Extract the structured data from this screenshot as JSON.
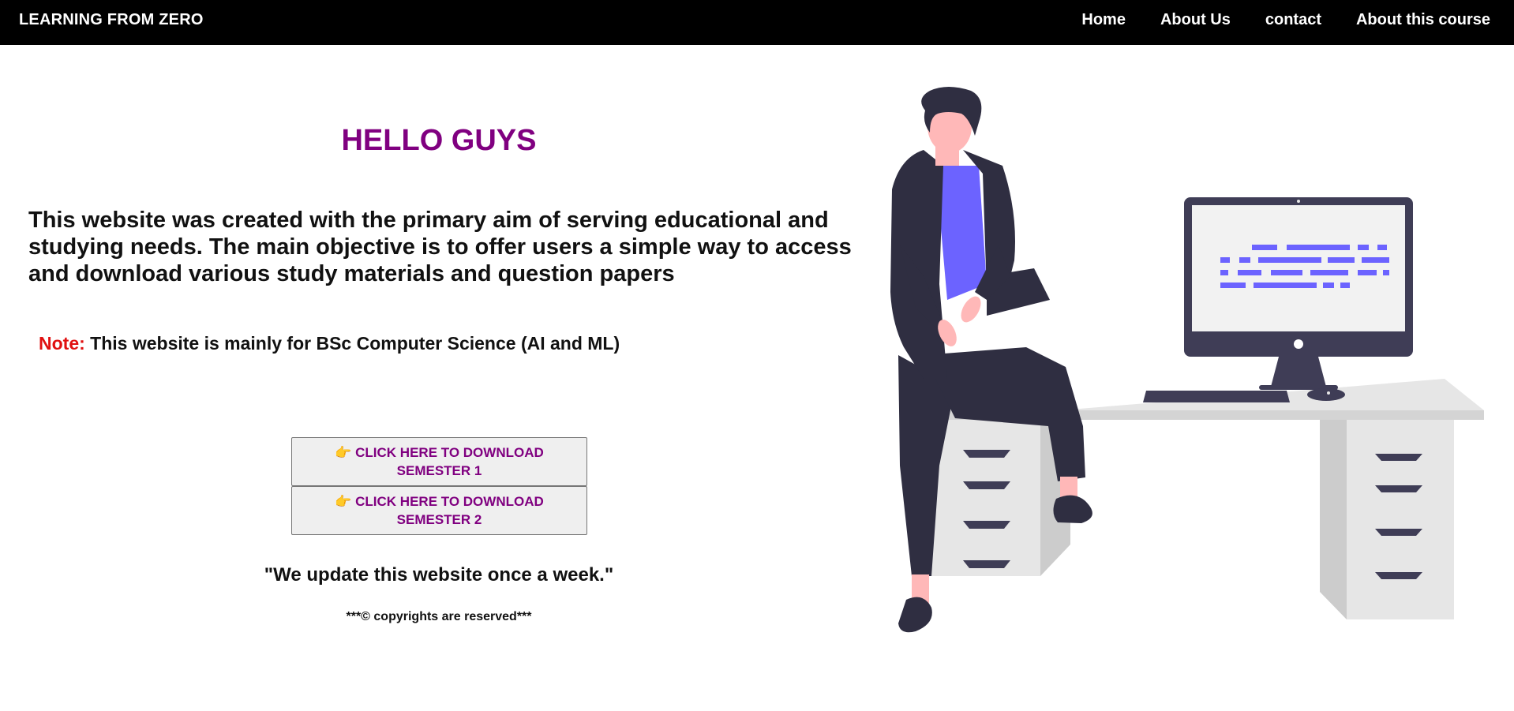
{
  "nav": {
    "brand": "LEARNING FROM ZERO",
    "links": [
      "Home",
      "About Us",
      "contact",
      "About this course"
    ]
  },
  "main": {
    "heading": "HELLO GUYS",
    "intro": "This website was created with the primary aim of serving educational and studying needs. The main objective is to offer users a simple way to access and download various study materials and question papers",
    "note_label": "Note:",
    "note_text": "This website is mainly for BSc Computer Science (AI and ML)",
    "buttons": [
      {
        "icon": "👉",
        "label": "CLICK HERE TO DOWNLOAD SEMESTER 1"
      },
      {
        "icon": "👉",
        "label": "CLICK HERE TO DOWNLOAD SEMESTER 2"
      }
    ],
    "update_text": "\"We update this website once a week.\"",
    "copyright": "***© copyrights are reserved***"
  },
  "colors": {
    "nav_bg": "#000000",
    "accent_purple": "#800080",
    "note_red": "#e01010",
    "illustration_primary": "#6c63ff",
    "illustration_dark": "#2f2e41",
    "skin": "#ffb8b8"
  }
}
